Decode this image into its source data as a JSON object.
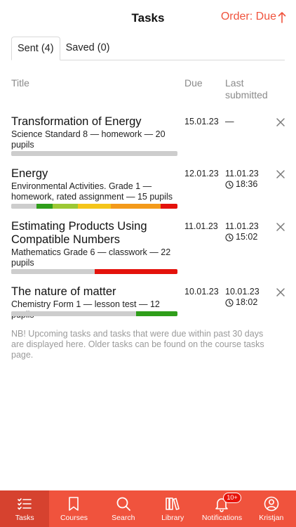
{
  "header": {
    "title": "Tasks",
    "order_label": "Order: Due",
    "order_icon": "arrow-up-icon",
    "accent_color": "#f0533d"
  },
  "tabs": [
    {
      "label": "Sent (4)",
      "active": true
    },
    {
      "label": "Saved (0)",
      "active": false
    }
  ],
  "columns": {
    "title": "Title",
    "due": "Due",
    "last_line1": "Last",
    "last_line2": "submitted"
  },
  "tasks": [
    {
      "name": "Transformation of Energy",
      "meta": "Science Standard 8 — homework — 20 pupils",
      "due": "15.01.23",
      "last_date": "—",
      "last_time": "",
      "progress": [
        {
          "color": "#cdcdcd",
          "fraction": 1.0
        }
      ]
    },
    {
      "name": "Energy",
      "meta": "Environmental Activities. Grade 1 — homework, rated assignment — 15 pupils",
      "due": "12.01.23",
      "last_date": "11.01.23",
      "last_time": "18:36",
      "progress": [
        {
          "color": "#cdcdcd",
          "fraction": 0.15
        },
        {
          "color": "#2f9e1a",
          "fraction": 0.1
        },
        {
          "color": "#9cc834",
          "fraction": 0.15
        },
        {
          "color": "#f4c51a",
          "fraction": 0.2
        },
        {
          "color": "#f39a1a",
          "fraction": 0.3
        },
        {
          "color": "#e4120c",
          "fraction": 0.1
        }
      ]
    },
    {
      "name": "Estimating Products Using Compatible Numbers",
      "meta": "Mathematics Grade 6 — classwork — 22 pupils",
      "due": "11.01.23",
      "last_date": "11.01.23",
      "last_time": "15:02",
      "progress": [
        {
          "color": "#cdcdcd",
          "fraction": 0.5
        },
        {
          "color": "#e4120c",
          "fraction": 0.5
        }
      ]
    },
    {
      "name": "The nature of matter",
      "meta": "Chemistry Form 1 — lesson test — 12 pupils",
      "due": "10.01.23",
      "last_date": "10.01.23",
      "last_time": "18:02",
      "progress": [
        {
          "color": "#cdcdcd",
          "fraction": 0.75
        },
        {
          "color": "#2f9e1a",
          "fraction": 0.25
        }
      ]
    }
  ],
  "note": "NB! Upcoming tasks and tasks that were due within past 30 days are displayed here. Older tasks can be found on the course tasks page.",
  "nav": [
    {
      "label": "Tasks",
      "icon": "tasks-checklist-icon",
      "active": true
    },
    {
      "label": "Courses",
      "icon": "bookmark-icon",
      "active": false
    },
    {
      "label": "Search",
      "icon": "search-icon",
      "active": false
    },
    {
      "label": "Library",
      "icon": "library-icon",
      "active": false
    },
    {
      "label": "Notifications",
      "icon": "bell-icon",
      "active": false,
      "badge": "10+"
    },
    {
      "label": "Kristjan",
      "icon": "user-icon",
      "active": false
    }
  ]
}
